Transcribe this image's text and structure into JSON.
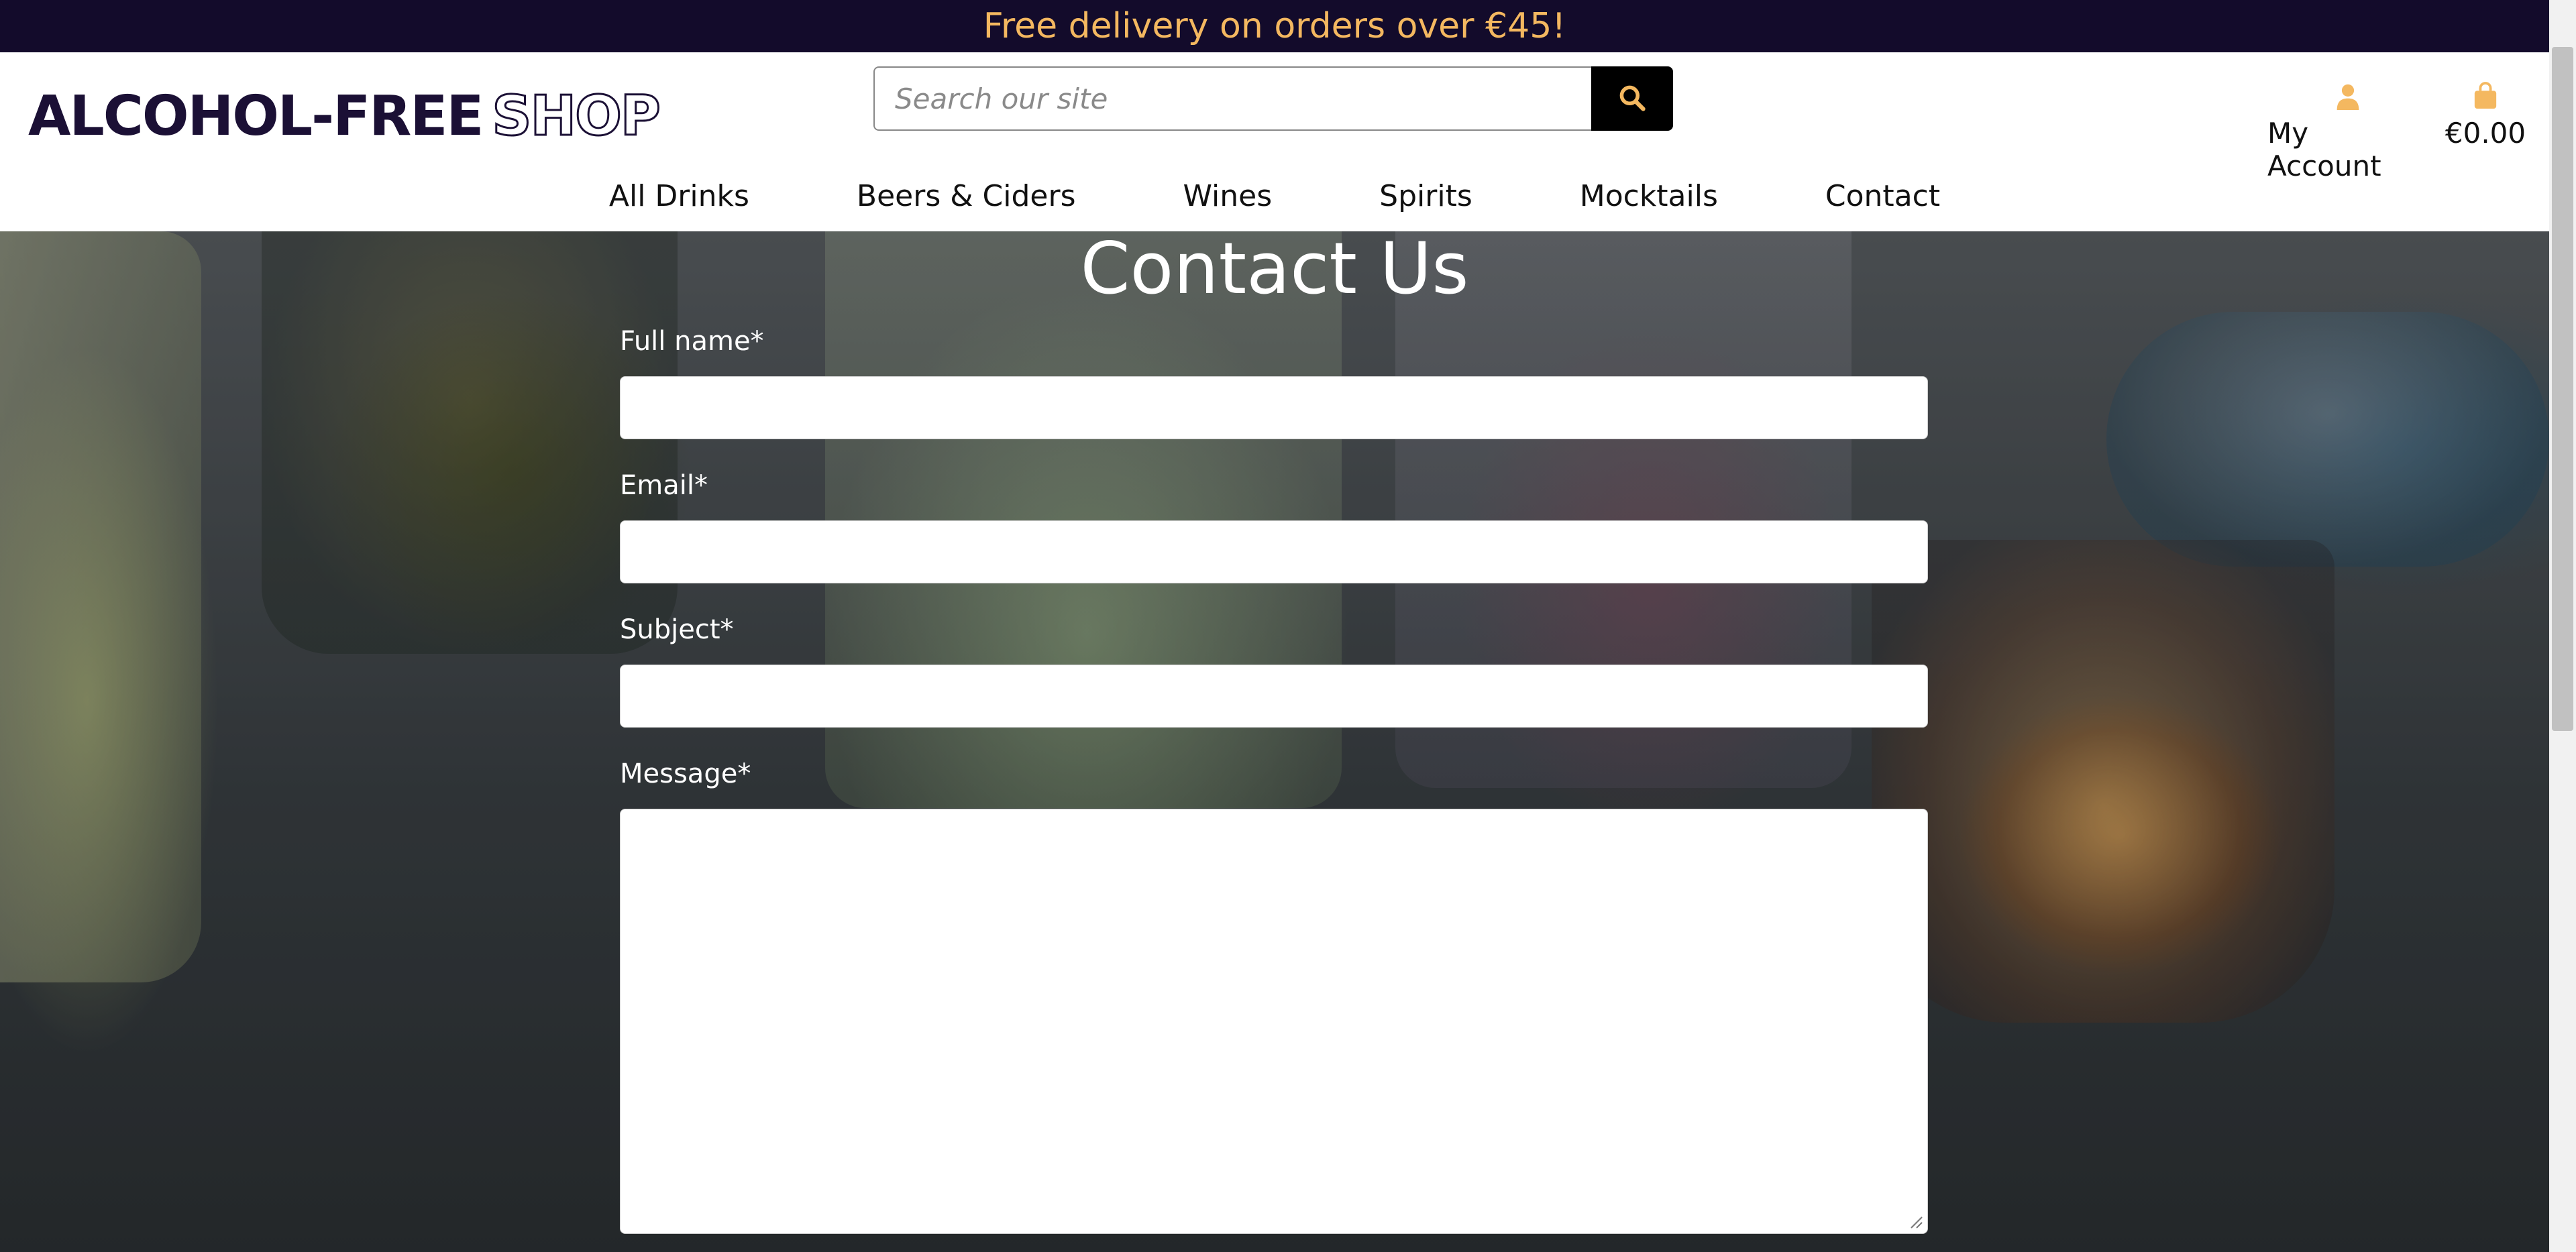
{
  "banner": {
    "text": "Free delivery on orders over €45!"
  },
  "header": {
    "logo_solid": "ALCOHOL-FREE",
    "logo_outline": "SHOP",
    "search_placeholder": "Search our site",
    "search_icon": "magnifier-icon",
    "account_label": "My Account",
    "account_icon": "user-icon",
    "cart_total": "€0.00",
    "cart_icon": "shopping-bag-icon",
    "icon_color": "#f4b860"
  },
  "nav": {
    "items": [
      {
        "label": "All Drinks"
      },
      {
        "label": "Beers & Ciders"
      },
      {
        "label": "Wines"
      },
      {
        "label": "Spirits"
      },
      {
        "label": "Mocktails"
      },
      {
        "label": "Contact"
      }
    ]
  },
  "contact": {
    "title": "Contact Us",
    "fields": [
      {
        "label": "Full name*",
        "value": ""
      },
      {
        "label": "Email*",
        "value": ""
      },
      {
        "label": "Subject*",
        "value": ""
      },
      {
        "label": "Message*",
        "value": ""
      }
    ]
  },
  "colors": {
    "banner_bg": "#130b2b",
    "banner_text": "#f4b860",
    "logo": "#1b1035"
  }
}
